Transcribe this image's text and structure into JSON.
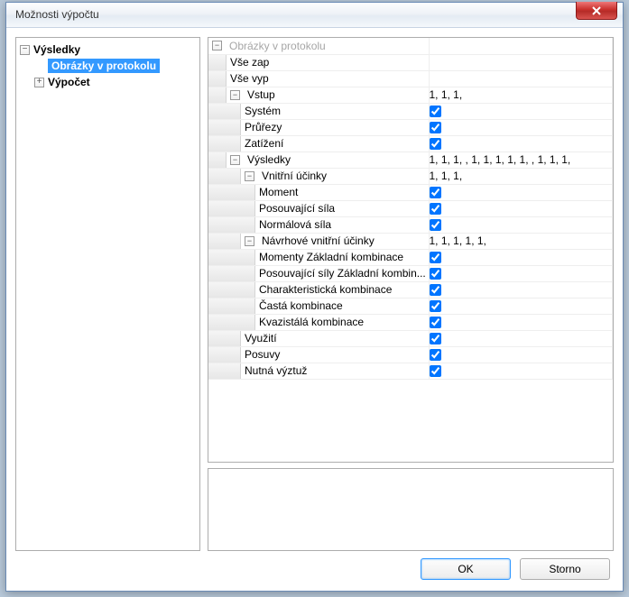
{
  "window": {
    "title": "Možnosti výpočtu"
  },
  "nav": {
    "root": "Výsledky",
    "selected": "Obrázky v protokolu",
    "sub": "Výpočet"
  },
  "grid": {
    "header": "Obrázky v protokolu",
    "rows": [
      {
        "label": "Vše zap",
        "value": "",
        "kind": "text",
        "indent": 0,
        "toggle": ""
      },
      {
        "label": "Vše vyp",
        "value": "",
        "kind": "text",
        "indent": 0,
        "toggle": ""
      },
      {
        "label": "Vstup",
        "value": "1, 1, 1,",
        "kind": "text",
        "indent": 0,
        "toggle": "-"
      },
      {
        "label": "Systém",
        "value": "",
        "kind": "check",
        "checked": true,
        "indent": 1,
        "toggle": ""
      },
      {
        "label": "Průřezy",
        "value": "",
        "kind": "check",
        "checked": true,
        "indent": 1,
        "toggle": ""
      },
      {
        "label": "Zatížení",
        "value": "",
        "kind": "check",
        "checked": true,
        "indent": 1,
        "toggle": ""
      },
      {
        "label": "Výsledky",
        "value": "1, 1, 1, , 1, 1, 1, 1, 1, , 1, 1, 1,",
        "kind": "text",
        "indent": 0,
        "toggle": "-"
      },
      {
        "label": "Vnitřní účinky",
        "value": "1, 1, 1,",
        "kind": "text",
        "indent": 1,
        "toggle": "-"
      },
      {
        "label": "Moment",
        "value": "",
        "kind": "check",
        "checked": true,
        "indent": 2,
        "toggle": ""
      },
      {
        "label": "Posouvající síla",
        "value": "",
        "kind": "check",
        "checked": true,
        "indent": 2,
        "toggle": ""
      },
      {
        "label": "Normálová síla",
        "value": "",
        "kind": "check",
        "checked": true,
        "indent": 2,
        "toggle": ""
      },
      {
        "label": "Návrhové vnitřní účinky",
        "value": "1, 1, 1, 1, 1,",
        "kind": "text",
        "indent": 1,
        "toggle": "-"
      },
      {
        "label": "Momenty Základní kombinace",
        "value": "",
        "kind": "check",
        "checked": true,
        "indent": 2,
        "toggle": ""
      },
      {
        "label": "Posouvající síly Základní kombin...",
        "value": "",
        "kind": "check",
        "checked": true,
        "indent": 2,
        "toggle": ""
      },
      {
        "label": "Charakteristická kombinace",
        "value": "",
        "kind": "check",
        "checked": true,
        "indent": 2,
        "toggle": ""
      },
      {
        "label": "Častá kombinace",
        "value": "",
        "kind": "check",
        "checked": true,
        "indent": 2,
        "toggle": ""
      },
      {
        "label": "Kvazistálá kombinace",
        "value": "",
        "kind": "check",
        "checked": true,
        "indent": 2,
        "toggle": ""
      },
      {
        "label": "Využití",
        "value": "",
        "kind": "check",
        "checked": true,
        "indent": 1,
        "toggle": ""
      },
      {
        "label": "Posuvy",
        "value": "",
        "kind": "check",
        "checked": true,
        "indent": 1,
        "toggle": ""
      },
      {
        "label": "Nutná výztuž",
        "value": "",
        "kind": "check",
        "checked": true,
        "indent": 1,
        "toggle": ""
      }
    ]
  },
  "buttons": {
    "ok": "OK",
    "cancel": "Storno"
  }
}
